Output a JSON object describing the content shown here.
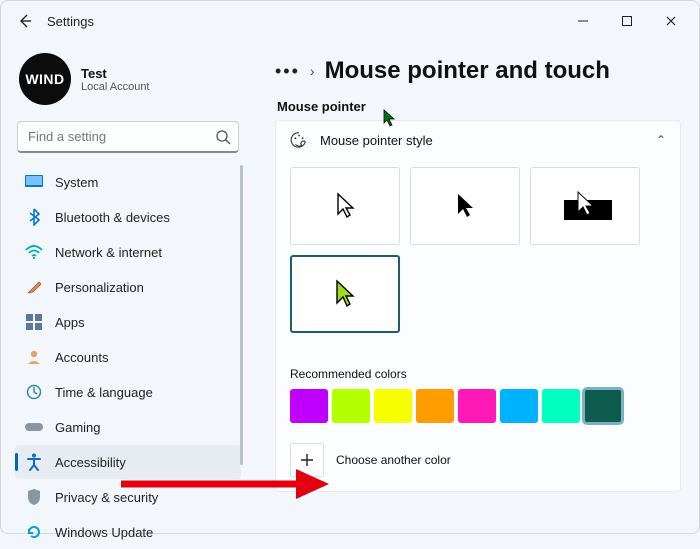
{
  "window": {
    "app_title": "Settings"
  },
  "profile": {
    "avatar_text": "WIND",
    "name": "Test",
    "subtitle": "Local Account"
  },
  "search": {
    "placeholder": "Find a setting"
  },
  "nav": {
    "items": [
      {
        "label": "System"
      },
      {
        "label": "Bluetooth & devices"
      },
      {
        "label": "Network & internet"
      },
      {
        "label": "Personalization"
      },
      {
        "label": "Apps"
      },
      {
        "label": "Accounts"
      },
      {
        "label": "Time & language"
      },
      {
        "label": "Gaming"
      },
      {
        "label": "Accessibility"
      },
      {
        "label": "Privacy & security"
      },
      {
        "label": "Windows Update"
      }
    ]
  },
  "page": {
    "title": "Mouse pointer and touch",
    "section": "Mouse pointer",
    "style_header": "Mouse pointer style",
    "recommended_label": "Recommended colors",
    "choose_label": "Choose another color"
  },
  "colors": {
    "swatches": [
      "#c000ff",
      "#b4ff00",
      "#f6ff00",
      "#ff9d00",
      "#ff1ab8",
      "#00b2ff",
      "#00ffc0",
      "#0d5c4d"
    ],
    "selected_index": 7,
    "selected_pointer_color": "#9cdc1b"
  }
}
